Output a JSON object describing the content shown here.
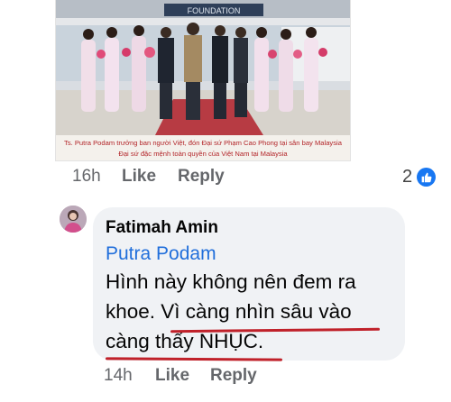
{
  "post_image": {
    "banner_text": "FOUNDATION",
    "caption_line1": "Ts. Putra Podam trưởng ban người Việt, đón Đại sứ Phạm Cao Phong tại sân bay Malaysia",
    "caption_line2": "Đại sứ đặc mệnh toàn quyền của Việt Nam tại Malaysia"
  },
  "top_actions": {
    "time": "16h",
    "like_label": "Like",
    "reply_label": "Reply",
    "reaction_count": "2",
    "reaction_icon": "like-thumb-icon"
  },
  "comment": {
    "author": "Fatimah Amin",
    "mention": "Putra Podam",
    "text_line1": "Hình này không nên đem ra",
    "text_line2_a": "khoe. ",
    "text_line2_b": "Vì càng nhìn sâu vào",
    "text_line3": "càng thấy NHỤC.",
    "underline_color": "#c0212a"
  },
  "comment_actions": {
    "time": "14h",
    "like_label": "Like",
    "reply_label": "Reply"
  },
  "colors": {
    "mention": "#216fdb",
    "meta_text": "#65676b",
    "bubble_bg": "#f0f2f5",
    "like_blue": "#1877f2"
  }
}
